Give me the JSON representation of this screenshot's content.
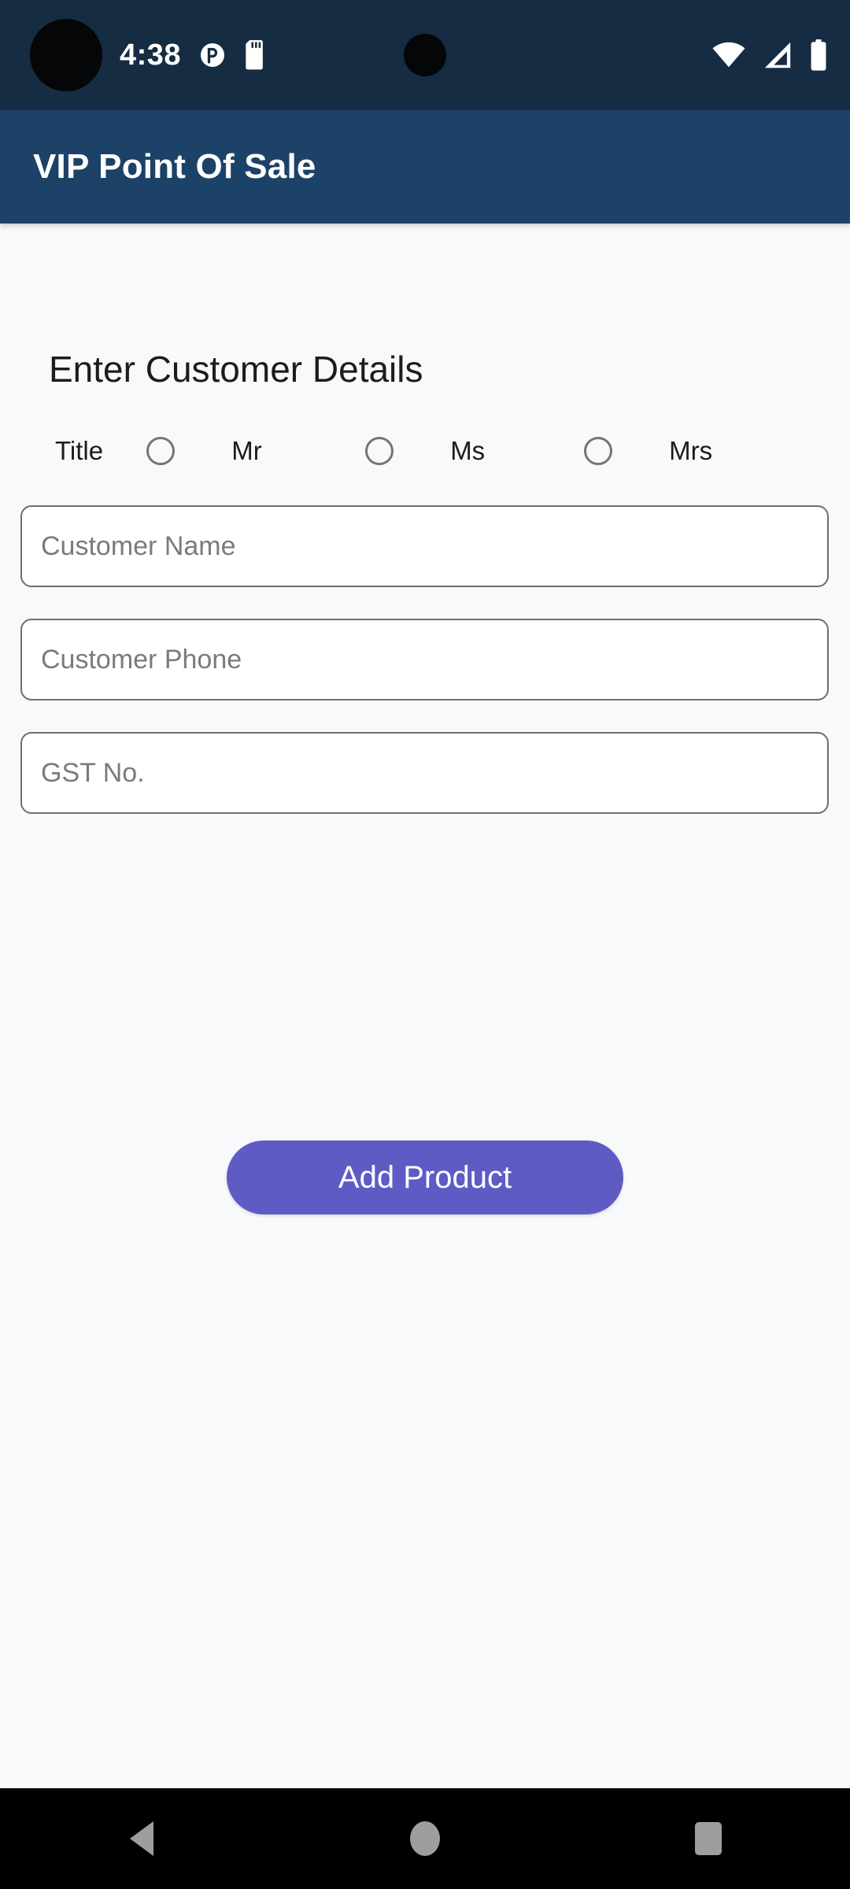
{
  "status_bar": {
    "clock": "4:38",
    "left_icons": [
      "dnd-icon",
      "sd-card-icon"
    ],
    "right_icons": [
      "wifi-icon",
      "cellular-signal-icon",
      "battery-icon"
    ],
    "background_color": "#152c42"
  },
  "app_bar": {
    "title": "VIP Point Of Sale",
    "background_color": "#1d4268",
    "text_color": "#ffffff"
  },
  "form": {
    "heading": "Enter Customer Details",
    "title_label": "Title",
    "title_options": [
      {
        "label": "Mr",
        "selected": false
      },
      {
        "label": "Ms",
        "selected": false
      },
      {
        "label": "Mrs",
        "selected": false
      }
    ],
    "fields": [
      {
        "name": "customer-name",
        "placeholder": "Customer Name",
        "value": ""
      },
      {
        "name": "customer-phone",
        "placeholder": "Customer Phone",
        "value": ""
      },
      {
        "name": "gst-no",
        "placeholder": "GST No.",
        "value": ""
      }
    ],
    "primary_button": {
      "label": "Add Product",
      "color": "#5f5bc5",
      "text_color": "#ffffff"
    },
    "background_color": "#f8f9fa"
  },
  "nav_bar": {
    "background_color": "#000000",
    "buttons": [
      "back-button",
      "home-button",
      "recents-button"
    ]
  }
}
